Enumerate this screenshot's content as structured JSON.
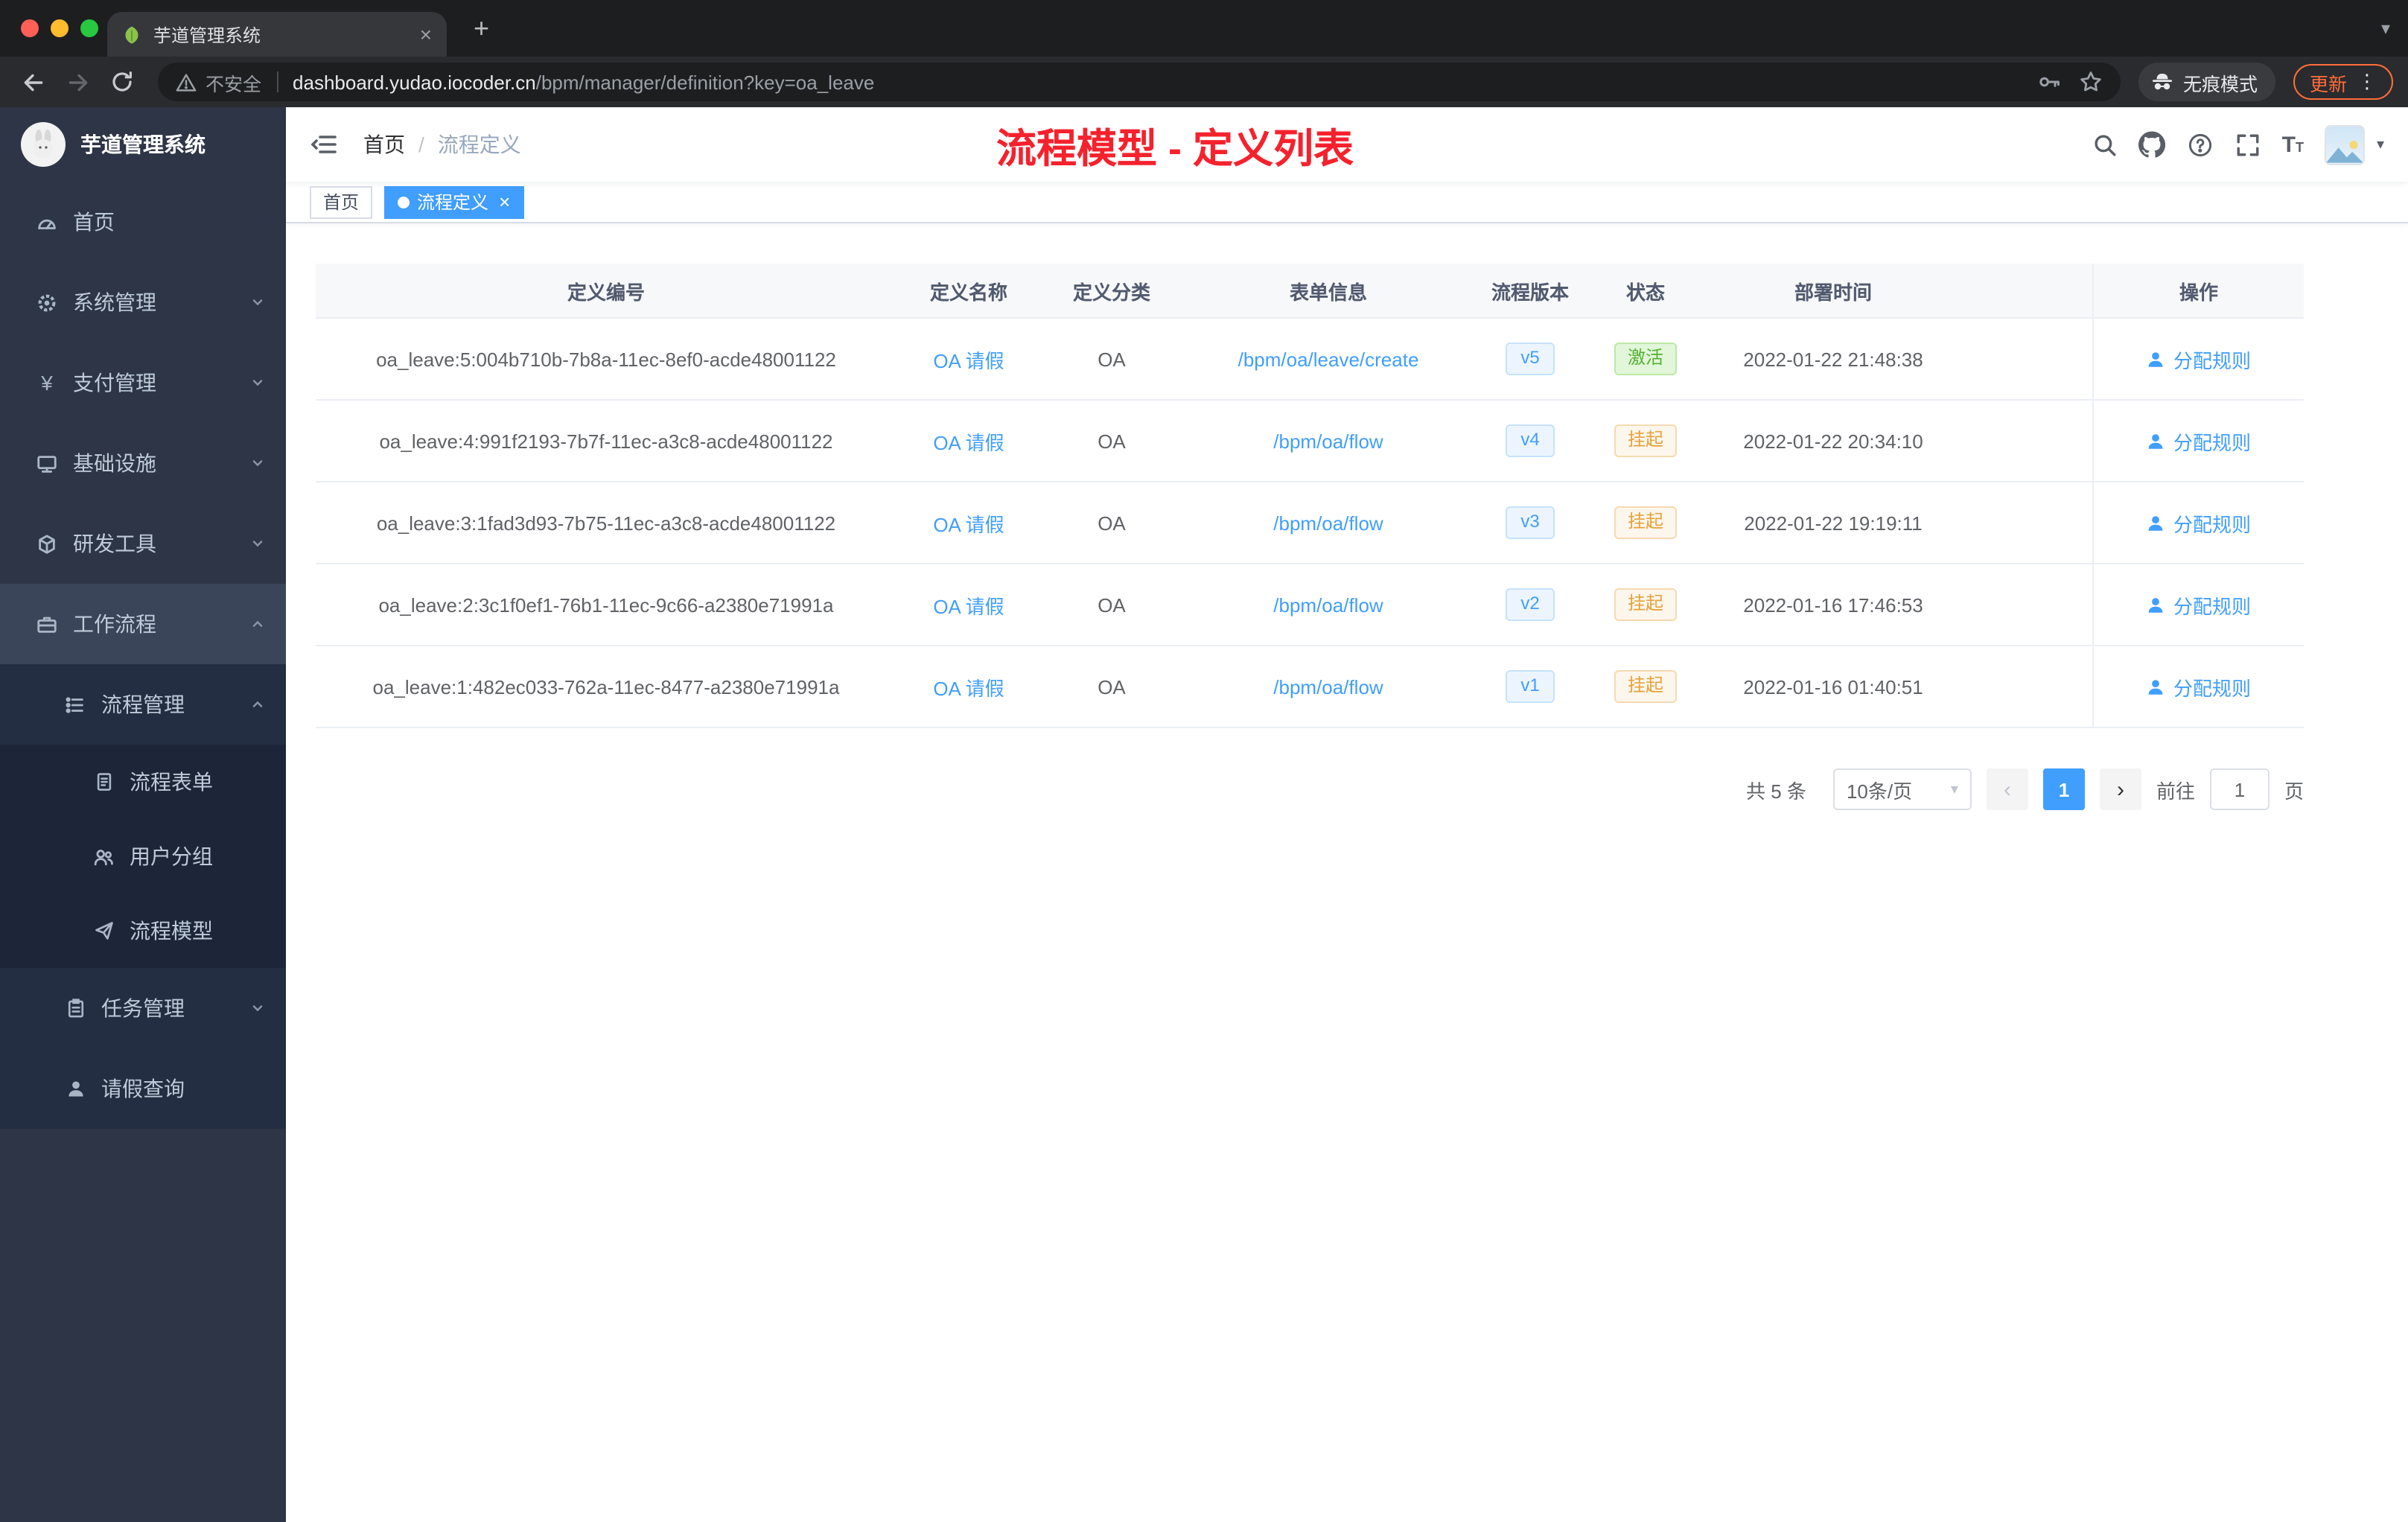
{
  "browser": {
    "tab": {
      "title": "芋道管理系统"
    },
    "toolbar": {
      "security_label": "不安全",
      "url_host": "dashboard.yudao.iocoder.cn",
      "url_path": "/bpm/manager/definition?key=oa_leave",
      "incognito_label": "无痕模式",
      "update_label": "更新"
    }
  },
  "sidebar": {
    "app_title": "芋道管理系统",
    "items": [
      {
        "label": "首页"
      },
      {
        "label": "系统管理"
      },
      {
        "label": "支付管理"
      },
      {
        "label": "基础设施"
      },
      {
        "label": "研发工具"
      },
      {
        "label": "工作流程"
      },
      {
        "label": "流程管理"
      },
      {
        "label": "流程表单"
      },
      {
        "label": "用户分组"
      },
      {
        "label": "流程模型"
      },
      {
        "label": "任务管理"
      },
      {
        "label": "请假查询"
      }
    ]
  },
  "header": {
    "breadcrumb_home": "首页",
    "breadcrumb_current": "流程定义",
    "annotation": "流程模型 - 定义列表"
  },
  "tags": {
    "home": "首页",
    "active": "流程定义"
  },
  "table": {
    "columns": [
      "定义编号",
      "定义名称",
      "定义分类",
      "表单信息",
      "流程版本",
      "状态",
      "部署时间",
      "操作"
    ],
    "rows": [
      {
        "id": "oa_leave:5:004b710b-7b8a-11ec-8ef0-acde48001122",
        "name": "OA 请假",
        "category": "OA",
        "form": "/bpm/oa/leave/create",
        "version": "v5",
        "status": "激活",
        "status_type": "success",
        "time": "2022-01-22 21:48:38",
        "action": "分配规则"
      },
      {
        "id": "oa_leave:4:991f2193-7b7f-11ec-a3c8-acde48001122",
        "name": "OA 请假",
        "category": "OA",
        "form": "/bpm/oa/flow",
        "version": "v4",
        "status": "挂起",
        "status_type": "warning",
        "time": "2022-01-22 20:34:10",
        "action": "分配规则"
      },
      {
        "id": "oa_leave:3:1fad3d93-7b75-11ec-a3c8-acde48001122",
        "name": "OA 请假",
        "category": "OA",
        "form": "/bpm/oa/flow",
        "version": "v3",
        "status": "挂起",
        "status_type": "warning",
        "time": "2022-01-22 19:19:11",
        "action": "分配规则"
      },
      {
        "id": "oa_leave:2:3c1f0ef1-76b1-11ec-9c66-a2380e71991a",
        "name": "OA 请假",
        "category": "OA",
        "form": "/bpm/oa/flow",
        "version": "v2",
        "status": "挂起",
        "status_type": "warning",
        "time": "2022-01-16 17:46:53",
        "action": "分配规则"
      },
      {
        "id": "oa_leave:1:482ec033-762a-11ec-8477-a2380e71991a",
        "name": "OA 请假",
        "category": "OA",
        "form": "/bpm/oa/flow",
        "version": "v1",
        "status": "挂起",
        "status_type": "warning",
        "time": "2022-01-16 01:40:51",
        "action": "分配规则"
      }
    ]
  },
  "pagination": {
    "total": "共 5 条",
    "page_size": "10条/页",
    "current_page": "1",
    "goto_label": "前往",
    "goto_value": "1",
    "page_unit": "页"
  },
  "glyphs": {
    "close": "×",
    "plus": "+",
    "caret_down": "▾",
    "kebab": "⋮",
    "slash": "/",
    "prev": "‹",
    "next": "›",
    "yen": "¥",
    "font_icon": "T"
  },
  "colors": {
    "primary": "#409eff",
    "success": "#67c23a",
    "warning": "#e6a23c",
    "annotation_red": "#f5222d"
  }
}
